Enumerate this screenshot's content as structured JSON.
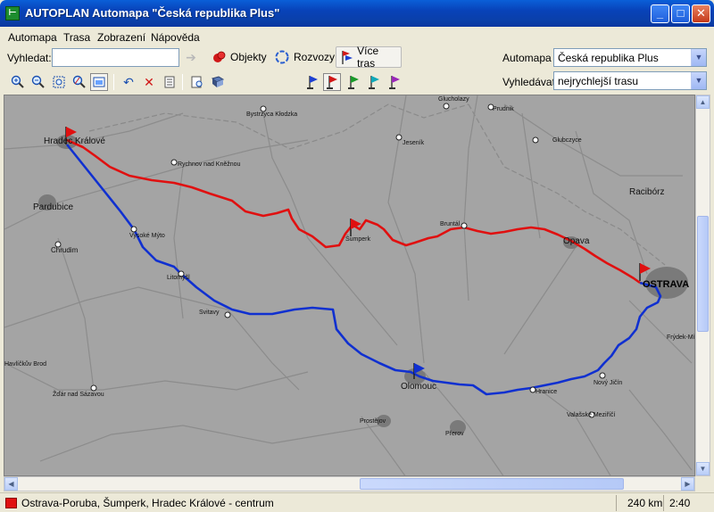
{
  "window": {
    "title": "AUTOPLAN Automapa \"Česká republika Plus\"",
    "app_icon_glyph": "⊢"
  },
  "menu": [
    "Automapa",
    "Trasa",
    "Zobrazení",
    "Nápověda"
  ],
  "search": {
    "label": "Vyhledat:",
    "value": "",
    "placeholder": ""
  },
  "buttons": {
    "objekty": "Objekty",
    "rozvozy": "Rozvozy",
    "vice_tras": "Více tras"
  },
  "automapa": {
    "label": "Automapa",
    "value": "Česká republika Plus"
  },
  "vyhledavat": {
    "label": "Vyhledávat",
    "value": "nejrychlejší trasu"
  },
  "map": {
    "cities": {
      "hradec": "Hradec Králové",
      "pardubice": "Pardubice",
      "chrudim": "Chrudim",
      "vysoke_myto": "Vysoké Mýto",
      "litomysl": "Litomyšl",
      "svitavy": "Svitavy",
      "rychnov": "Rychnov nad Kněžnou",
      "bystrzyca": "Bystrzyca Kłodzka",
      "jesenik": "Jeseník",
      "glucholazy": "Glucholazy",
      "prudnik": "Prudnik",
      "glubczyce": "Glubczyce",
      "raciborz": "Racibórz",
      "sumperk": "Šumperk",
      "bruntal": "Bruntál",
      "opava": "Opava",
      "ostrava": "OSTRAVA",
      "frydek": "Frýdek-Mí",
      "olomouc": "Olomouc",
      "hranice": "Hranice",
      "novy_jicin": "Nový Jičín",
      "valasske": "Valašské Meziříčí",
      "prostejov": "Prostějov",
      "prerov": "Přerov",
      "havlickuv": "Havlíčkův Brod",
      "zdar": "Žďár nad Sázavou"
    }
  },
  "status": {
    "route": "Ostrava-Poruba, Šumperk, Hradec Králové - centrum",
    "distance": "240 km",
    "time": "2:40"
  },
  "colors": {
    "route_red": "#e01010",
    "route_blue": "#1030d0",
    "map_bg": "#a3a3a3"
  }
}
